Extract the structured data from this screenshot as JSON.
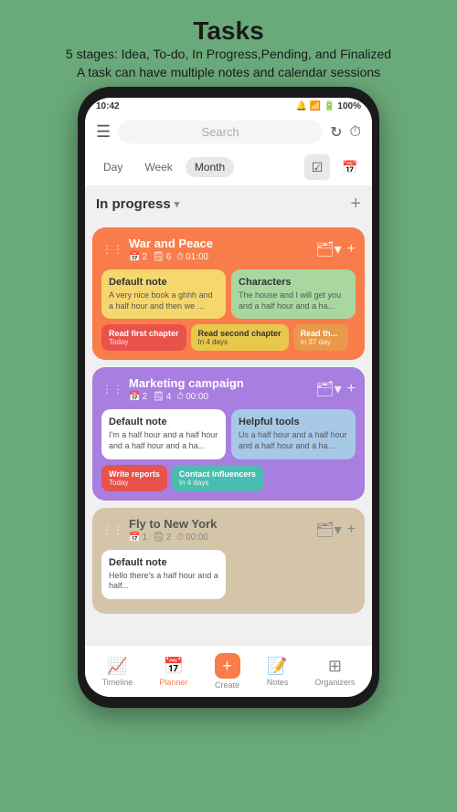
{
  "header": {
    "title": "Tasks",
    "subtitle_line1": "5 stages: Idea, To-do, In Progress,Pending, and Finalized",
    "subtitle_line2": "A task can have multiple notes and calendar sessions"
  },
  "status_bar": {
    "time": "10:42",
    "battery": "100%",
    "icons": "signal wifi battery"
  },
  "app_header": {
    "search_placeholder": "Search",
    "refresh_icon": "↻",
    "timer_icon": "⏱"
  },
  "tabs": {
    "items": [
      "Day",
      "Week",
      "Month"
    ],
    "active": "Month"
  },
  "section": {
    "title": "In progress",
    "chevron": "▾",
    "add_icon": "+"
  },
  "tasks": [
    {
      "id": "war-and-peace",
      "title": "War and Peace",
      "color": "orange",
      "meta": {
        "sessions": "2",
        "notes": "6",
        "time": "01:00"
      },
      "notes": [
        {
          "title": "Default note",
          "text": "A very nice book a ghhh and a half hour and then we ...",
          "color": "yellow"
        },
        {
          "title": "Characters",
          "text": "The house and I will get you and a half hour and a ha...",
          "color": "green-light"
        }
      ],
      "sessions": [
        {
          "label": "Read first chapter",
          "sub": "Today",
          "color": "red"
        },
        {
          "label": "Read second chapter",
          "sub": "In 4 days",
          "color": "yellow-pill"
        },
        {
          "label": "Read th...",
          "sub": "In 37 day",
          "color": "orange-pill"
        }
      ]
    },
    {
      "id": "marketing-campaign",
      "title": "Marketing campaign",
      "color": "purple",
      "meta": {
        "sessions": "2",
        "notes": "4",
        "time": "00:00"
      },
      "notes": [
        {
          "title": "Default note",
          "text": "I'm a half hour and a half hour and a half hour and a ha...",
          "color": "white"
        },
        {
          "title": "Helpful tools",
          "text": "Us a half hour and a half hour and a half hour and a ha...",
          "color": "blue-light"
        }
      ],
      "sessions": [
        {
          "label": "Write reports",
          "sub": "Today",
          "color": "red"
        },
        {
          "label": "Contact influencers",
          "sub": "In 4 days",
          "color": "teal-pill"
        }
      ]
    },
    {
      "id": "fly-to-new-york",
      "title": "Fly to New York",
      "color": "beige",
      "meta": {
        "sessions": "1",
        "notes": "2",
        "time": "00:00"
      },
      "notes": [
        {
          "title": "Default note",
          "text": "Hello there's a half hour and a half...",
          "color": "white"
        }
      ],
      "sessions": []
    }
  ],
  "bottom_nav": {
    "items": [
      {
        "id": "timeline",
        "label": "Timeline",
        "icon": "📈",
        "active": false
      },
      {
        "id": "planner",
        "label": "Planner",
        "icon": "📅",
        "active": true
      },
      {
        "id": "create",
        "label": "Create",
        "icon": "+",
        "active": false,
        "special": true
      },
      {
        "id": "notes",
        "label": "Notes",
        "icon": "📝",
        "active": false
      },
      {
        "id": "organizers",
        "label": "Organizers",
        "icon": "⊞",
        "active": false
      }
    ]
  }
}
